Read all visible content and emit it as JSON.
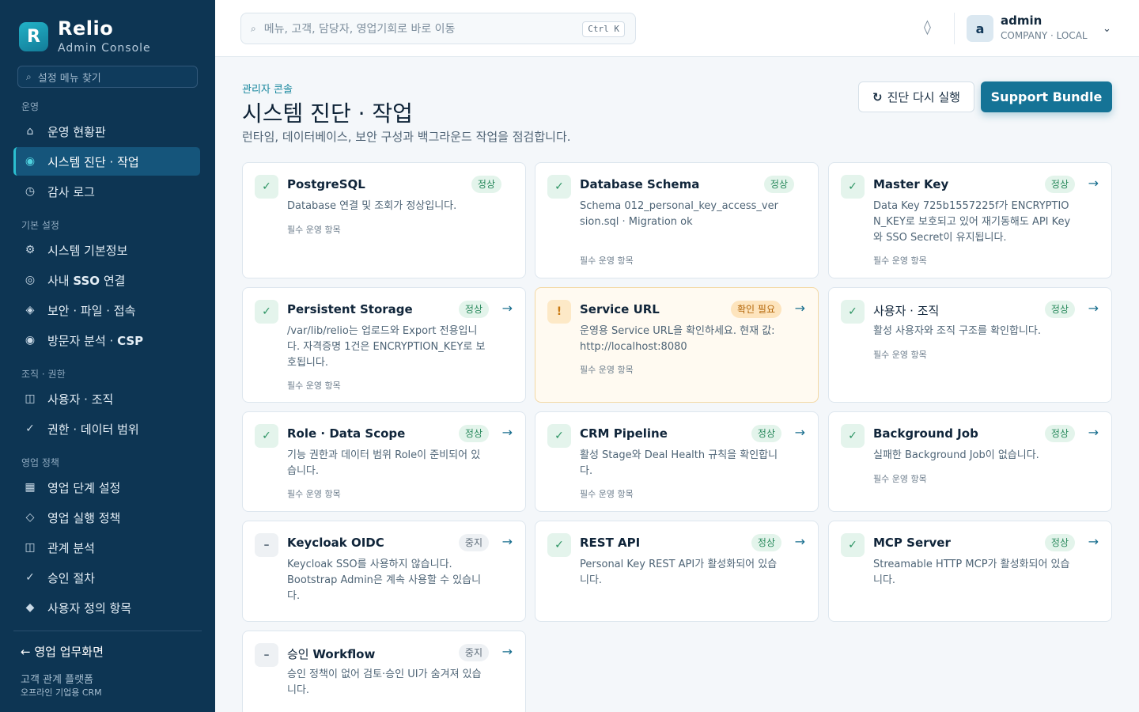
{
  "brand": {
    "logo_letter": "R",
    "name": "Relio",
    "sub": "Admin Console"
  },
  "sidebar": {
    "search_placeholder": "설정 메뉴 찾기",
    "sections": {
      "ops": "운영",
      "basic": "기본 설정",
      "org": "조직 · 권한",
      "sales": "영업 정책"
    },
    "items": {
      "dashboard": {
        "icon": "⌂",
        "label": "운영 현황판"
      },
      "diagnostics": {
        "icon": "◉",
        "label": "시스템 진단 · 작업"
      },
      "audit": {
        "icon": "◷",
        "label": "감사 로그"
      },
      "system_info": {
        "icon": "⚙",
        "label": "시스템 기본정보"
      },
      "sso_prefix": "사내 ",
      "sso_strong": "SSO",
      "sso_suffix": " 연결",
      "sso_icon": "◎",
      "security": {
        "icon": "◈",
        "label": "보안 · 파일 · 접속"
      },
      "csp_prefix": "방문자 분석 · ",
      "csp_strong": "CSP",
      "csp_icon": "◉",
      "users": {
        "icon": "◫",
        "label": "사용자 · 조직"
      },
      "permissions": {
        "icon": "✓",
        "label": "권한 · 데이터 범위"
      },
      "stages": {
        "icon": "▦",
        "label": "영업 단계 설정"
      },
      "execution": {
        "icon": "◇",
        "label": "영업 실행 정책"
      },
      "relations": {
        "icon": "◫",
        "label": "관계 분석"
      },
      "approval": {
        "icon": "✓",
        "label": "승인 절차"
      },
      "custom_fields": {
        "icon": "◆",
        "label": "사용자 정의 항목"
      }
    },
    "back_link": "← 영업 업무화면",
    "footer_line1": "고객 관계 플랫폼",
    "footer_line2": "오프라인 기업용 CRM"
  },
  "topbar": {
    "search_placeholder": "메뉴, 고객, 담당자, 영업기회로 바로 이동",
    "shortcut": "Ctrl K",
    "theme_icon": "◊",
    "user": {
      "initial": "a",
      "name": "admin",
      "meta": "COMPANY · LOCAL",
      "chevron": "⌄"
    }
  },
  "page": {
    "breadcrumb": "관리자 콘솔",
    "title": "시스템 진단 · 작업",
    "description": "런타임, 데이터베이스, 보안 구성과 백그라운드 작업을 점검합니다.",
    "rerun_icon": "↻",
    "rerun_label": "진단 다시 실행",
    "bundle_label": "Support Bundle"
  },
  "cards": {
    "postgres": {
      "icon": "✓",
      "title": "PostgreSQL",
      "badge": "정상",
      "desc": "Database 연결 및 조회가 정상입니다.",
      "foot": "필수 운영 항목"
    },
    "schema": {
      "icon": "✓",
      "title": "Database Schema",
      "badge": "정상",
      "desc": "Schema 012_personal_key_access_version.sql · Migration ok",
      "foot": "필수 운영 항목"
    },
    "masterkey": {
      "icon": "✓",
      "title": "Master Key",
      "badge": "정상",
      "arrow": "→",
      "desc": "Data Key 725b1557225f가 ENCRYPTION_KEY로 보호되고 있어 재기동해도 API Key와 SSO Secret이 유지됩니다.",
      "foot": "필수 운영 항목"
    },
    "storage": {
      "icon": "✓",
      "title": "Persistent Storage",
      "badge": "정상",
      "arrow": "→",
      "desc": "/var/lib/relio는 업로드와 Export 전용입니다. 자격증명 1건은 ENCRYPTION_KEY로 보호됩니다.",
      "foot": "필수 운영 항목"
    },
    "serviceurl": {
      "icon": "!",
      "title": "Service URL",
      "badge": "확인 필요",
      "arrow": "→",
      "desc": "운영용 Service URL을 확인하세요. 현재 값: http://localhost:8080",
      "foot": "필수 운영 항목"
    },
    "userorg": {
      "icon": "✓",
      "title": "사용자 · 조직",
      "badge": "정상",
      "arrow": "→",
      "desc": "활성 사용자와 조직 구조를 확인합니다.",
      "foot": "필수 운영 항목"
    },
    "role": {
      "icon": "✓",
      "title": "Role · Data Scope",
      "badge": "정상",
      "arrow": "→",
      "desc": "기능 권한과 데이터 범위 Role이 준비되어 있습니다.",
      "foot": "필수 운영 항목"
    },
    "pipeline": {
      "icon": "✓",
      "title": "CRM Pipeline",
      "badge": "정상",
      "arrow": "→",
      "desc": "활성 Stage와 Deal Health 규칙을 확인합니다.",
      "foot": "필수 운영 항목"
    },
    "bgjob": {
      "icon": "✓",
      "title": "Background Job",
      "badge": "정상",
      "arrow": "→",
      "desc": "실패한 Background Job이 없습니다.",
      "foot": "필수 운영 항목"
    },
    "keycloak": {
      "icon": "–",
      "title": "Keycloak OIDC",
      "badge": "중지",
      "arrow": "→",
      "desc": "Keycloak SSO를 사용하지 않습니다. Bootstrap Admin은 계속 사용할 수 있습니다."
    },
    "restapi": {
      "icon": "✓",
      "title": "REST API",
      "badge": "정상",
      "arrow": "→",
      "desc": "Personal Key REST API가 활성화되어 있습니다."
    },
    "mcp": {
      "icon": "✓",
      "title": "MCP Server",
      "badge": "정상",
      "arrow": "→",
      "desc": "Streamable HTTP MCP가 활성화되어 있습니다."
    },
    "workflow": {
      "icon": "–",
      "title_prefix": "승인 ",
      "title_strong": "Workflow",
      "badge": "중지",
      "arrow": "→",
      "desc": "승인 정책이 없어 검토·승인 UI가 숨겨져 있습니다."
    }
  }
}
